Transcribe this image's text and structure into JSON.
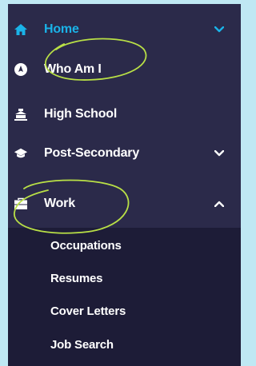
{
  "nav": {
    "items": [
      {
        "label": "Home",
        "icon": "home-icon",
        "active": true,
        "chevron": "down"
      },
      {
        "label": "Who Am I",
        "icon": "compass-icon"
      },
      {
        "label": "High School",
        "icon": "school-building-icon"
      },
      {
        "label": "Post-Secondary",
        "icon": "graduation-cap-icon",
        "chevron": "down"
      },
      {
        "label": "Work",
        "icon": "briefcase-icon",
        "chevron": "up"
      }
    ],
    "work_submenu": [
      "Occupations",
      "Resumes",
      "Cover Letters",
      "Job Search"
    ]
  },
  "colors": {
    "page_background": "#bfe8f3",
    "menu_background": "#2b2a4a",
    "submenu_background": "#1d1c37",
    "active_accent": "#1ab3e8",
    "text": "#ffffff",
    "highlight_circle": "#b9e046"
  },
  "annotations": {
    "highlighted_items": [
      "Who Am I",
      "Work"
    ]
  }
}
